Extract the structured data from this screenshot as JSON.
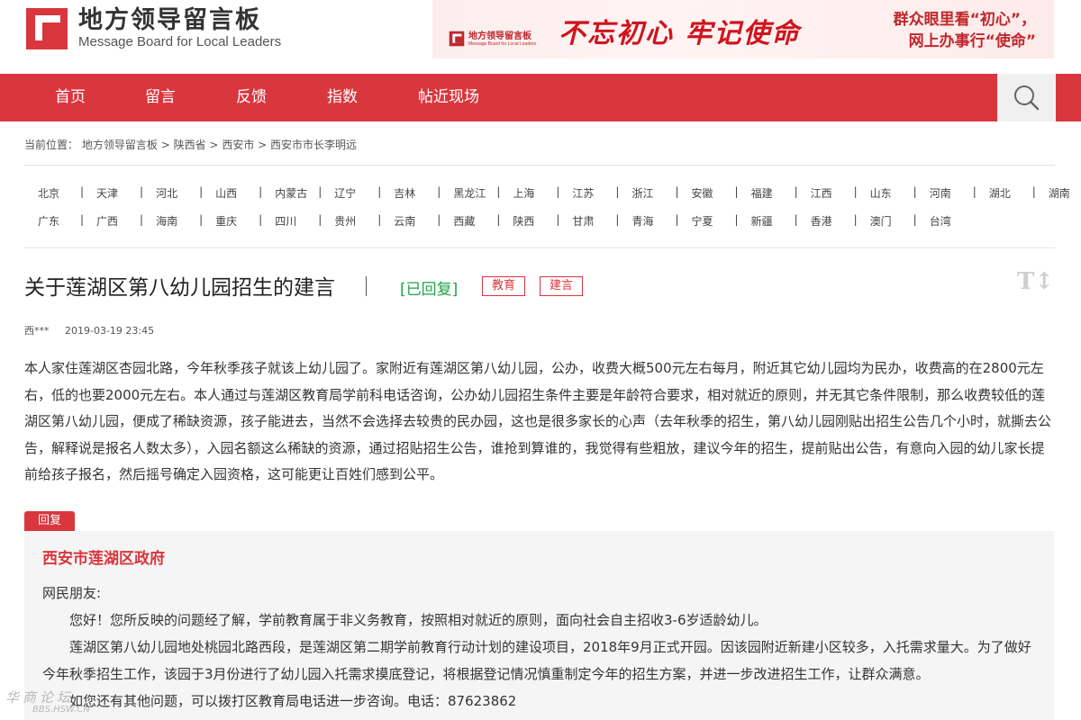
{
  "header": {
    "logo_cn": "地方领导留言板",
    "logo_en": "Message Board for Local Leaders"
  },
  "banner": {
    "logo_cn": "地方领导留言板",
    "logo_en": "Message Board for Local Leaders",
    "slogan": "不忘初心 牢记使命",
    "right_line1": "群众眼里看“初心”，",
    "right_line2": "网上办事行“使命”"
  },
  "nav": {
    "items": [
      "首页",
      "留言",
      "反馈",
      "指数",
      "帖近现场"
    ]
  },
  "breadcrumb": {
    "prefix": "当前位置：",
    "items": [
      "地方领导留言板",
      "陕西省",
      "西安市",
      "西安市市长李明远"
    ],
    "separator": ">"
  },
  "provinces": {
    "row1": [
      "北京",
      "天津",
      "河北",
      "山西",
      "内蒙古",
      "辽宁",
      "吉林",
      "黑龙江",
      "上海",
      "江苏",
      "浙江",
      "安徽",
      "福建",
      "江西",
      "山东",
      "河南",
      "湖北",
      "湖南"
    ],
    "row2": [
      "广东",
      "广西",
      "海南",
      "重庆",
      "四川",
      "贵州",
      "云南",
      "西藏",
      "陕西",
      "甘肃",
      "青海",
      "宁夏",
      "新疆",
      "香港",
      "澳门",
      "台湾"
    ]
  },
  "message": {
    "title": "关于莲湖区第八幼儿园招生的建言",
    "status": "[已回复]",
    "tags": [
      "教育",
      "建言"
    ],
    "font_toggle": "T↕",
    "author": "西***",
    "date": "2019-03-19 23:45",
    "body": "本人家住莲湖区杏园北路，今年秋季孩子就该上幼儿园了。家附近有莲湖区第八幼儿园，公办，收费大概500元左右每月，附近其它幼儿园均为民办，收费高的在2800元左右，低的也要2000元左右。本人通过与莲湖区教育局学前科电话咨询，公办幼儿园招生条件主要是年龄符合要求，相对就近的原则，并无其它条件限制，那么收费较低的莲湖区第八幼儿园，便成了稀缺资源，孩子能进去，当然不会选择去较贵的民办园，这也是很多家长的心声（去年秋季的招生，第八幼儿园刚贴出招生公告几个小时，就撕去公告，解释说是报名人数太多），入园名额这么稀缺的资源，通过招贴招生公告，谁抢到算谁的，我觉得有些粗放，建议今年的招生，提前贴出公告，有意向入园的幼儿家长提前给孩子报名，然后摇号确定入园资格，这可能更让百姓们感到公平。"
  },
  "reply": {
    "tab_label": "回复",
    "org": "西安市莲湖区政府",
    "greeting": "网民朋友:",
    "paragraphs": [
      "您好！您所反映的问题经了解，学前教育属于非义务教育，按照相对就近的原则，面向社会自主招收3-6岁适龄幼儿。",
      "莲湖区第八幼儿园地处桃园北路西段，是莲湖区第二期学前教育行动计划的建设项目，2018年9月正式开园。因该园附近新建小区较多，入托需求量大。为了做好今年秋季招生工作，该园于3月份进行了幼儿园入托需求摸底登记，将根据登记情况慎重制定今年的招生方案，并进一步改进招生工作，让群众满意。",
      "如您还有其他问题，可以拨打区教育局电话进一步咨询。电话：87623862"
    ]
  },
  "watermark": {
    "cn": "华商论坛",
    "en": "BBS.HSW.CN"
  },
  "colors": {
    "brand_red": "#d9363e",
    "status_green": "#22a249"
  }
}
